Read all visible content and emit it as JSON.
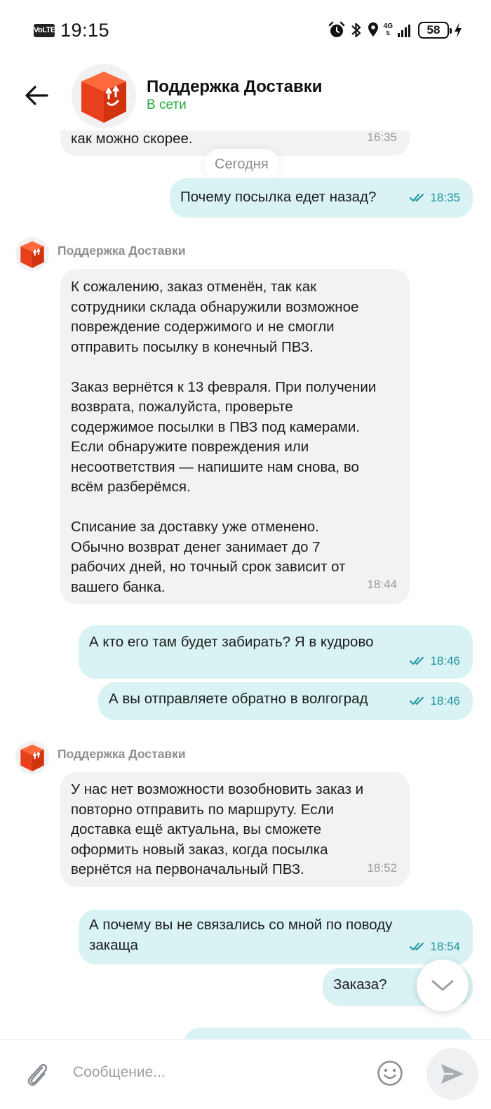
{
  "status_bar": {
    "volte": "VoLTE",
    "time": "19:15",
    "network": "4G",
    "battery": "58"
  },
  "header": {
    "title": "Поддержка Доставки",
    "status": "В сети",
    "status_color": "#27a943"
  },
  "date_separator": "Сегодня",
  "messages": [
    {
      "direction": "incoming",
      "text": "как можно скорее.",
      "time": "16:35"
    },
    {
      "direction": "outgoing",
      "text": "Почему посылка едет назад?",
      "time": "18:35",
      "read": true
    },
    {
      "direction": "incoming",
      "sender": "Поддержка Доставки",
      "text": "К сожалению, заказ отменён, так как\nсотрудники склада обнаружили возможное\nповреждение содержимого и не смогли\nотправить посылку в конечный ПВЗ.\n\nЗаказ вернётся к 13 февраля. При получении\nвозврата, пожалуйста, проверьте\nсодержимое посылки в ПВЗ под камерами.\nЕсли обнаружите повреждения или\nнесоответствия — напишите нам снова, во\nвсём разберёмся.\n\nСписание за доставку уже отменено.\nОбычно возврат денег занимает до 7\nрабочих дней, но точный срок зависит от\nвашего банка.",
      "time": "18:44"
    },
    {
      "direction": "outgoing",
      "text": "А кто его там будет забирать? Я в кудрово",
      "time": "18:46",
      "read": true
    },
    {
      "direction": "outgoing",
      "text": "А вы отправляете обратно в волгоград",
      "time": "18:46",
      "read": true
    },
    {
      "direction": "incoming",
      "sender": "Поддержка Доставки",
      "text": "У нас нет возможности возобновить заказ и\nповторно отправить по маршруту. Если\nдоставка ещё актуальна, вы сможете\nоформить новый заказ, когда посылка\nвернётся на первоначальный ПВЗ.",
      "time": "18:52"
    },
    {
      "direction": "outgoing",
      "text": "А почему вы не связались со мной по поводу\nзакаща",
      "time": "18:54",
      "read": true
    },
    {
      "direction": "outgoing",
      "text": "Заказа?",
      "read": true
    }
  ],
  "composer": {
    "placeholder": "Сообщение..."
  },
  "icons": {
    "back": "arrow-left-icon",
    "attach": "paperclip-icon",
    "emoji": "smiley-icon",
    "send": "send-icon",
    "scroll_down": "chevron-down-icon",
    "avatar": "orange-box-logo"
  },
  "colors": {
    "incoming_bubble": "#f1f2f4",
    "outgoing_bubble": "#d9f2f4",
    "read_ticks": "#1d93a0",
    "brand_orange": "#f0441e"
  }
}
